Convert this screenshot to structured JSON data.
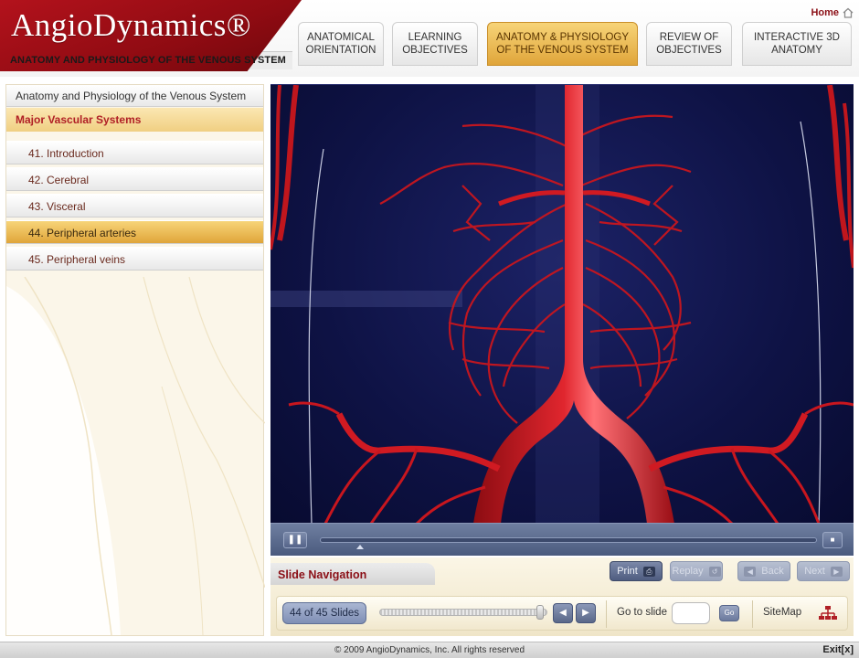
{
  "brand": {
    "logo": "AngioDynamics®",
    "subtitle": "ANATOMY AND PHYSIOLOGY OF THE VENOUS SYSTEM",
    "brand_color": "#a5141c"
  },
  "header": {
    "home_label": "Home",
    "home_icon": "house-icon",
    "tabs": [
      {
        "label": "ANATOMICAL\nORIENTATION",
        "active": false
      },
      {
        "label": "LEARNING\nOBJECTIVES",
        "active": false
      },
      {
        "label": "ANATOMY & PHYSIOLOGY\nOF THE VENOUS SYSTEM",
        "active": true
      },
      {
        "label": "REVIEW OF\nOBJECTIVES",
        "active": false
      },
      {
        "label": "INTERACTIVE 3D\nANATOMY",
        "active": false
      }
    ]
  },
  "sidebar": {
    "header": "Anatomy and Physiology of the Venous System",
    "section": "Major Vascular Systems",
    "items": [
      {
        "label": "41. Introduction",
        "active": false
      },
      {
        "label": "42. Cerebral",
        "active": false
      },
      {
        "label": "43. Visceral",
        "active": false
      },
      {
        "label": "44. Peripheral arteries",
        "active": true
      },
      {
        "label": "45. Peripheral veins",
        "active": false
      }
    ]
  },
  "viewer": {
    "content": "3D render of abdominal aorta and iliac arteries",
    "background_color": "#0e1244",
    "vessel_color": "#d01a22"
  },
  "playbar": {
    "pause_icon": "pause-icon",
    "stop_icon": "stop-icon",
    "progress": 0.08
  },
  "navigation": {
    "title": "Slide Navigation",
    "buttons": {
      "print": {
        "label": "Print",
        "icon": "printer-icon"
      },
      "replay": {
        "label": "Replay",
        "icon": "replay-icon"
      },
      "back": {
        "label": "Back",
        "icon": "left-arrow-icon"
      },
      "next": {
        "label": "Next",
        "icon": "right-arrow-icon"
      }
    },
    "slide_count": "44 of 45 Slides",
    "slide_position": 0.98,
    "goto_label": "Go to slide",
    "goto_value": "",
    "go_label": "Go",
    "sitemap_label": "SiteMap",
    "sitemap_icon": "sitemap-icon"
  },
  "footer": {
    "copyright": "© 2009 AngioDynamics, Inc. All rights reserved",
    "exit_label": "Exit[x]"
  }
}
